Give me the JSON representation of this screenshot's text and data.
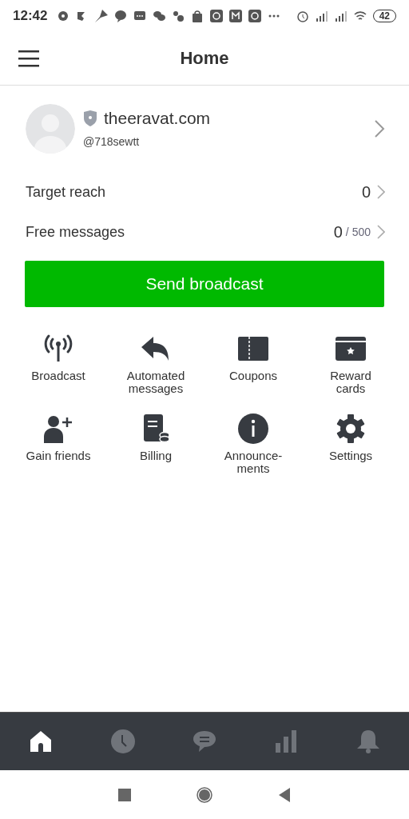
{
  "status_bar": {
    "time": "12:42",
    "battery": "42"
  },
  "header": {
    "title": "Home"
  },
  "profile": {
    "name": "theeravat.com",
    "handle": "@718sewtt"
  },
  "stats": [
    {
      "kind": "plain",
      "label": "Target reach",
      "value": "0"
    },
    {
      "kind": "quota",
      "label": "Free messages",
      "value": "0",
      "limit": "/ 500"
    }
  ],
  "primary_button": "Send broadcast",
  "features": [
    {
      "kind": "broadcast",
      "label": "Broadcast"
    },
    {
      "kind": "reply",
      "label": "Automated messages"
    },
    {
      "kind": "coupon",
      "label": "Coupons"
    },
    {
      "kind": "card",
      "label": "Reward cards"
    },
    {
      "kind": "addperson",
      "label": "Gain friends"
    },
    {
      "kind": "billing",
      "label": "Billing"
    },
    {
      "kind": "info",
      "label": "Announce-ments"
    },
    {
      "kind": "gear",
      "label": "Settings"
    }
  ],
  "tab_bar": [
    {
      "kind": "home",
      "selected": true
    },
    {
      "kind": "clock",
      "selected": false
    },
    {
      "kind": "chat",
      "selected": false
    },
    {
      "kind": "chart",
      "selected": false
    },
    {
      "kind": "bell",
      "selected": false
    }
  ]
}
